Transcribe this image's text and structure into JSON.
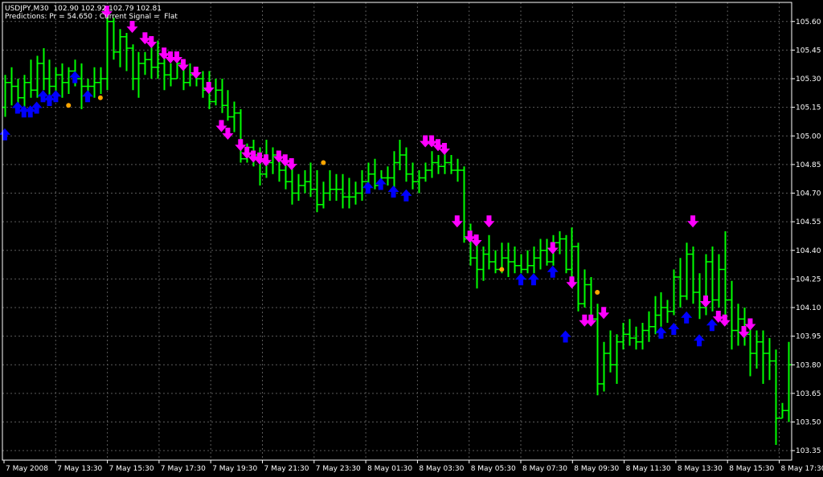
{
  "header": {
    "symbol_line": "USDJPY,M30  102.90 102.92 102.79 102.81",
    "predictions_line": "Predictions: Pr = 54.650 ; Current Signal =  Flat"
  },
  "colors": {
    "background": "#000000",
    "grid": "#5a5a5a",
    "axis": "#ffffff",
    "bar": "#00ff00",
    "buy_arrow": "#0000ff",
    "sell_arrow": "#ff00ff",
    "flat_dot": "#ffa500",
    "text": "#ffffff"
  },
  "chart_data": {
    "type": "bar",
    "subtype": "ohlc",
    "grid": true,
    "ylim": [
      103.3,
      105.7
    ],
    "y_ticks": [
      "105.60",
      "105.45",
      "105.30",
      "105.15",
      "105.00",
      "104.85",
      "104.70",
      "104.55",
      "104.40",
      "104.25",
      "104.10",
      "103.95",
      "103.80",
      "103.65",
      "103.50",
      "103.35"
    ],
    "x_ticks": [
      "7 May 2008",
      "7 May 13:30",
      "7 May 15:30",
      "7 May 17:30",
      "7 May 19:30",
      "7 May 21:30",
      "7 May 23:30",
      "8 May 01:30",
      "8 May 03:30",
      "8 May 05:30",
      "8 May 07:30",
      "8 May 09:30",
      "8 May 11:30",
      "8 May 13:30",
      "8 May 15:30",
      "8 May 17:30"
    ],
    "bars": [
      [
        105.15,
        105.32,
        105.1,
        105.28
      ],
      [
        105.28,
        105.36,
        105.16,
        105.26
      ],
      [
        105.26,
        105.3,
        105.12,
        105.2
      ],
      [
        105.2,
        105.32,
        105.14,
        105.28
      ],
      [
        105.28,
        105.4,
        105.2,
        105.24
      ],
      [
        105.24,
        105.42,
        105.2,
        105.38
      ],
      [
        105.38,
        105.46,
        105.24,
        105.3
      ],
      [
        105.3,
        105.4,
        105.18,
        105.26
      ],
      [
        105.26,
        105.36,
        105.2,
        105.32
      ],
      [
        105.32,
        105.38,
        105.2,
        105.28
      ],
      [
        105.28,
        105.36,
        105.22,
        105.34
      ],
      [
        105.34,
        105.4,
        105.26,
        105.3
      ],
      [
        105.3,
        105.38,
        105.14,
        105.26
      ],
      [
        105.26,
        105.3,
        105.18,
        105.26
      ],
      [
        105.26,
        105.36,
        105.2,
        105.28
      ],
      [
        105.28,
        105.36,
        105.22,
        105.3
      ],
      [
        105.3,
        105.66,
        105.24,
        105.6
      ],
      [
        105.6,
        105.62,
        105.4,
        105.44
      ],
      [
        105.44,
        105.56,
        105.36,
        105.52
      ],
      [
        105.52,
        105.54,
        105.34,
        105.46
      ],
      [
        105.46,
        105.48,
        105.24,
        105.3
      ],
      [
        105.3,
        105.44,
        105.2,
        105.38
      ],
      [
        105.38,
        105.44,
        105.32,
        105.4
      ],
      [
        105.4,
        105.48,
        105.3,
        105.36
      ],
      [
        105.36,
        105.5,
        105.3,
        105.38
      ],
      [
        105.38,
        105.42,
        105.24,
        105.32
      ],
      [
        105.32,
        105.38,
        105.26,
        105.3
      ],
      [
        105.3,
        105.44,
        105.3,
        105.38
      ],
      [
        105.38,
        105.4,
        105.24,
        105.28
      ],
      [
        105.28,
        105.38,
        105.26,
        105.32
      ],
      [
        105.32,
        105.36,
        105.26,
        105.3
      ],
      [
        105.3,
        105.34,
        105.2,
        105.24
      ],
      [
        105.24,
        105.34,
        105.14,
        105.18
      ],
      [
        105.18,
        105.3,
        105.16,
        105.24
      ],
      [
        105.24,
        105.3,
        105.12,
        105.16
      ],
      [
        105.16,
        105.24,
        105.08,
        105.1
      ],
      [
        105.1,
        105.18,
        105.02,
        105.12
      ],
      [
        105.12,
        105.14,
        104.86,
        104.88
      ],
      [
        104.88,
        104.96,
        104.86,
        104.94
      ],
      [
        104.94,
        104.98,
        104.84,
        104.9
      ],
      [
        104.9,
        104.94,
        104.74,
        104.8
      ],
      [
        104.8,
        104.98,
        104.78,
        104.86
      ],
      [
        104.86,
        104.94,
        104.8,
        104.9
      ],
      [
        104.9,
        104.92,
        104.76,
        104.82
      ],
      [
        104.82,
        104.9,
        104.72,
        104.76
      ],
      [
        104.76,
        104.86,
        104.64,
        104.7
      ],
      [
        104.7,
        104.8,
        104.66,
        104.74
      ],
      [
        104.74,
        104.82,
        104.7,
        104.76
      ],
      [
        104.76,
        104.86,
        104.68,
        104.72
      ],
      [
        104.72,
        104.82,
        104.6,
        104.64
      ],
      [
        104.64,
        104.76,
        104.62,
        104.7
      ],
      [
        104.7,
        104.82,
        104.66,
        104.72
      ],
      [
        104.72,
        104.8,
        104.66,
        104.72
      ],
      [
        104.72,
        104.8,
        104.62,
        104.68
      ],
      [
        104.68,
        104.78,
        104.62,
        104.68
      ],
      [
        104.68,
        104.76,
        104.64,
        104.7
      ],
      [
        104.7,
        104.82,
        104.66,
        104.76
      ],
      [
        104.76,
        104.86,
        104.74,
        104.8
      ],
      [
        104.8,
        104.88,
        104.72,
        104.74
      ],
      [
        104.74,
        104.82,
        104.72,
        104.78
      ],
      [
        104.78,
        104.84,
        104.74,
        104.78
      ],
      [
        104.78,
        104.92,
        104.72,
        104.86
      ],
      [
        104.86,
        104.98,
        104.82,
        104.9
      ],
      [
        104.9,
        104.94,
        104.76,
        104.8
      ],
      [
        104.8,
        104.86,
        104.72,
        104.76
      ],
      [
        104.76,
        104.82,
        104.7,
        104.78
      ],
      [
        104.78,
        104.86,
        104.76,
        104.82
      ],
      [
        104.82,
        104.92,
        104.78,
        104.86
      ],
      [
        104.86,
        104.9,
        104.8,
        104.84
      ],
      [
        104.84,
        104.92,
        104.8,
        104.86
      ],
      [
        104.86,
        104.9,
        104.8,
        104.82
      ],
      [
        104.82,
        104.88,
        104.76,
        104.82
      ],
      [
        104.82,
        104.84,
        104.44,
        104.46
      ],
      [
        104.46,
        104.54,
        104.32,
        104.36
      ],
      [
        104.36,
        104.48,
        104.2,
        104.3
      ],
      [
        104.3,
        104.42,
        104.24,
        104.38
      ],
      [
        104.38,
        104.48,
        104.3,
        104.34
      ],
      [
        104.34,
        104.4,
        104.28,
        104.3
      ],
      [
        104.3,
        104.44,
        104.28,
        104.36
      ],
      [
        104.36,
        104.44,
        104.26,
        104.34
      ],
      [
        104.34,
        104.42,
        104.28,
        104.32
      ],
      [
        104.32,
        104.38,
        104.28,
        104.3
      ],
      [
        104.3,
        104.4,
        104.28,
        104.32
      ],
      [
        104.32,
        104.42,
        104.28,
        104.36
      ],
      [
        104.36,
        104.46,
        104.3,
        104.4
      ],
      [
        104.4,
        104.46,
        104.32,
        104.34
      ],
      [
        104.34,
        104.48,
        104.32,
        104.44
      ],
      [
        104.44,
        104.5,
        104.38,
        104.46
      ],
      [
        104.46,
        104.48,
        104.28,
        104.3
      ],
      [
        104.3,
        104.52,
        104.26,
        104.42
      ],
      [
        104.42,
        104.44,
        104.08,
        104.12
      ],
      [
        104.12,
        104.3,
        104.1,
        104.22
      ],
      [
        104.22,
        104.26,
        104.02,
        104.04
      ],
      [
        104.04,
        104.12,
        103.64,
        103.7
      ],
      [
        103.7,
        103.92,
        103.66,
        103.86
      ],
      [
        103.86,
        103.98,
        103.76,
        103.8
      ],
      [
        103.8,
        103.96,
        103.7,
        103.92
      ],
      [
        103.92,
        104.02,
        103.88,
        103.96
      ],
      [
        103.96,
        104.04,
        103.9,
        103.94
      ],
      [
        103.94,
        104.0,
        103.88,
        103.92
      ],
      [
        103.92,
        104.02,
        103.88,
        103.98
      ],
      [
        103.98,
        104.08,
        103.92,
        104.0
      ],
      [
        104.0,
        104.16,
        103.96,
        104.06
      ],
      [
        104.06,
        104.18,
        104.0,
        104.1
      ],
      [
        104.1,
        104.14,
        104.02,
        104.08
      ],
      [
        104.08,
        104.3,
        104.06,
        104.26
      ],
      [
        104.26,
        104.36,
        104.1,
        104.16
      ],
      [
        104.16,
        104.44,
        104.14,
        104.38
      ],
      [
        104.38,
        104.42,
        104.12,
        104.18
      ],
      [
        104.18,
        104.28,
        104.04,
        104.1
      ],
      [
        104.1,
        104.38,
        104.06,
        104.34
      ],
      [
        104.34,
        104.42,
        104.08,
        104.14
      ],
      [
        104.14,
        104.38,
        104.1,
        104.3
      ],
      [
        104.3,
        104.5,
        104.04,
        104.14
      ],
      [
        104.14,
        104.24,
        103.88,
        103.98
      ],
      [
        103.98,
        104.12,
        103.9,
        104.04
      ],
      [
        104.04,
        104.1,
        103.9,
        103.96
      ],
      [
        103.96,
        104.0,
        103.74,
        103.86
      ],
      [
        103.86,
        103.98,
        103.78,
        103.92
      ],
      [
        103.92,
        103.98,
        103.7,
        103.86
      ],
      [
        103.86,
        103.94,
        103.72,
        103.82
      ],
      [
        103.82,
        103.88,
        103.38,
        103.52
      ],
      [
        103.52,
        103.6,
        103.52,
        103.56
      ],
      [
        103.56,
        103.92,
        103.5,
        103.8
      ]
    ],
    "buy_signals": [
      [
        0,
        105.04
      ],
      [
        2,
        105.18
      ],
      [
        3,
        105.16
      ],
      [
        4,
        105.16
      ],
      [
        5,
        105.18
      ],
      [
        6,
        105.24
      ],
      [
        7,
        105.22
      ],
      [
        8,
        105.24
      ],
      [
        11,
        105.34
      ],
      [
        13,
        105.24
      ],
      [
        57,
        104.76
      ],
      [
        59,
        104.78
      ],
      [
        61,
        104.74
      ],
      [
        63,
        104.72
      ],
      [
        81,
        104.28
      ],
      [
        83,
        104.28
      ],
      [
        86,
        104.32
      ],
      [
        88,
        103.98
      ],
      [
        103,
        104.0
      ],
      [
        105,
        104.02
      ],
      [
        107,
        104.08
      ],
      [
        109,
        103.96
      ],
      [
        111,
        104.04
      ]
    ],
    "sell_signals": [
      [
        16,
        105.62
      ],
      [
        20,
        105.54
      ],
      [
        22,
        105.48
      ],
      [
        23,
        105.46
      ],
      [
        25,
        105.4
      ],
      [
        26,
        105.38
      ],
      [
        27,
        105.38
      ],
      [
        28,
        105.34
      ],
      [
        30,
        105.3
      ],
      [
        32,
        105.22
      ],
      [
        34,
        105.02
      ],
      [
        35,
        104.98
      ],
      [
        37,
        104.92
      ],
      [
        38,
        104.88
      ],
      [
        39,
        104.86
      ],
      [
        40,
        104.85
      ],
      [
        41,
        104.84
      ],
      [
        43,
        104.86
      ],
      [
        44,
        104.84
      ],
      [
        45,
        104.82
      ],
      [
        66,
        104.94
      ],
      [
        67,
        104.94
      ],
      [
        68,
        104.92
      ],
      [
        69,
        104.9
      ],
      [
        71,
        104.52
      ],
      [
        73,
        104.44
      ],
      [
        74,
        104.42
      ],
      [
        76,
        104.52
      ],
      [
        86,
        104.38
      ],
      [
        89,
        104.2
      ],
      [
        91,
        104.0
      ],
      [
        92,
        104.0
      ],
      [
        94,
        104.04
      ],
      [
        108,
        104.52
      ],
      [
        110,
        104.1
      ],
      [
        112,
        104.02
      ],
      [
        113,
        104.0
      ],
      [
        116,
        103.94
      ],
      [
        117,
        103.98
      ]
    ],
    "flat_signals": [
      [
        10,
        105.16
      ],
      [
        15,
        105.2
      ],
      [
        50,
        104.86
      ],
      [
        78,
        104.3
      ],
      [
        93,
        104.18
      ]
    ]
  }
}
